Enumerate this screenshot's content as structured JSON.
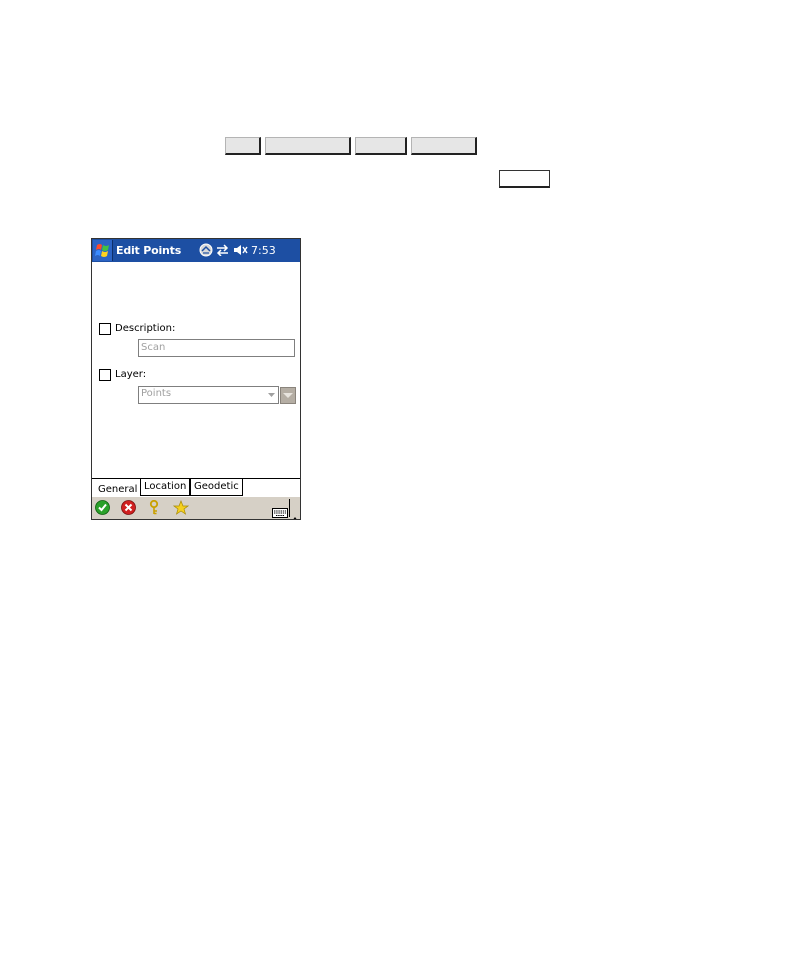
{
  "window": {
    "title": "Edit Points",
    "clock": "7:53",
    "icons": [
      "windows-start-icon",
      "connectivity-icon",
      "sync-arrows-icon",
      "volume-muted-icon"
    ]
  },
  "form": {
    "description": {
      "label": "Description:",
      "value": "Scan",
      "checked": false
    },
    "layer": {
      "label": "Layer:",
      "value": "Points",
      "checked": false
    }
  },
  "tabs": [
    {
      "label": "General",
      "active": true
    },
    {
      "label": "Location",
      "active": false
    },
    {
      "label": "Geodetic",
      "active": false
    }
  ],
  "toolbar": {
    "icons": [
      "ok-icon",
      "cancel-icon",
      "help-key-icon",
      "favorite-star-icon",
      "keyboard-icon",
      "sip-up-arrow-icon"
    ]
  },
  "colors": {
    "titlebar": "#1d4fa3",
    "toolbar": "#d6d0c6",
    "ok": "#2aa02a",
    "cancel": "#d02020"
  }
}
